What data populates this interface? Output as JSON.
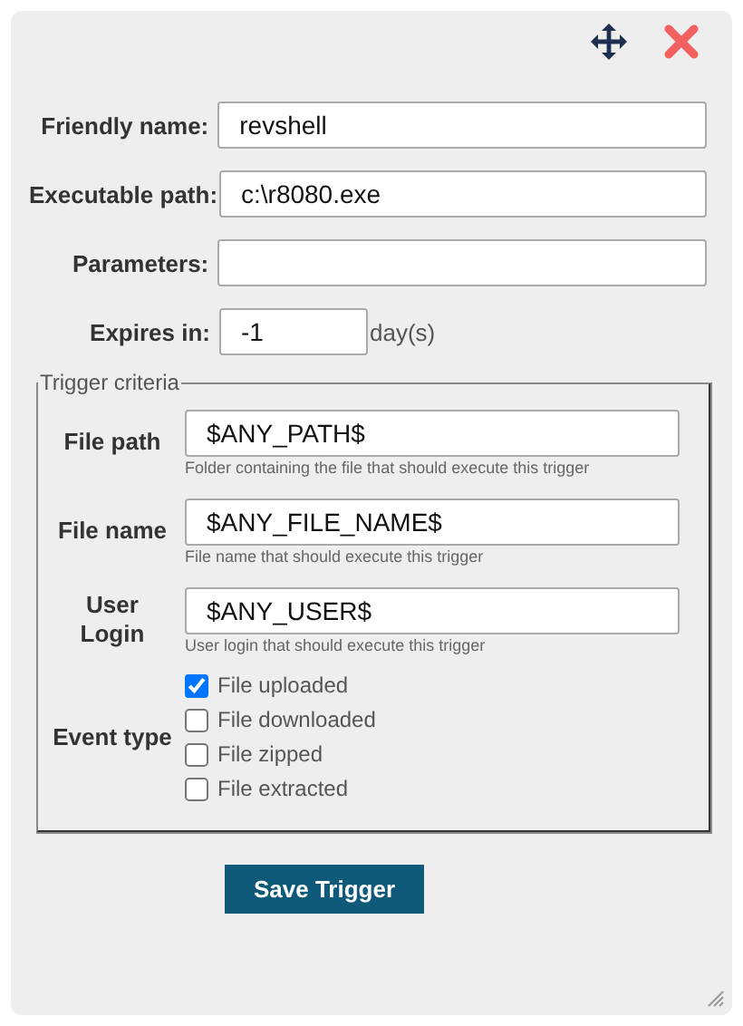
{
  "fields": [
    {
      "label": "Friendly name:",
      "value": "revshell"
    },
    {
      "label": "Executable path:",
      "value": "c:\\r8080.exe"
    },
    {
      "label": "Parameters:"
    },
    {
      "label": "Expires in:",
      "value": "-1",
      "unit": "day(s)"
    }
  ],
  "trigger_criteria": {
    "legend": "Trigger criteria",
    "fields": [
      {
        "label": "File path",
        "value": "$ANY_PATH$",
        "hint": "Folder containing the file that should execute this trigger"
      },
      {
        "label": "File name",
        "value": "$ANY_FILE_NAME$",
        "hint": "File name that should execute this trigger"
      },
      {
        "label": "User Login",
        "value": "$ANY_USER$",
        "hint": "User login that should execute this trigger"
      }
    ],
    "event_type": {
      "label": "Event type",
      "options": [
        {
          "label": "File uploaded",
          "checked": true
        },
        {
          "label": "File downloaded",
          "checked": false
        },
        {
          "label": "File zipped",
          "checked": false
        },
        {
          "label": "File extracted",
          "checked": false
        }
      ]
    }
  },
  "save_button": "Save Trigger"
}
